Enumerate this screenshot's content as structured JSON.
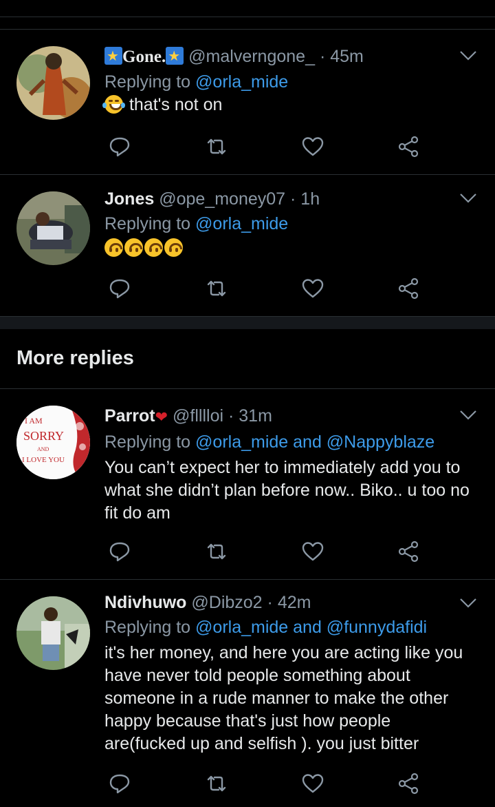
{
  "tweets": [
    {
      "name": "Gone.",
      "handle": "@malverngone_",
      "time": "45m",
      "reply_prefix": "Replying to",
      "mentions": "@orla_mide",
      "text": "that's not on",
      "emoji": "face-with-tears-of-joy"
    },
    {
      "name": "Jones",
      "handle": "@ope_money07",
      "time": "1h",
      "reply_prefix": "Replying to",
      "mentions": "@orla_mide",
      "emoji": "upside-down-face x4"
    },
    {
      "name": "Parrot",
      "handle": "@flllloi",
      "time": "31m",
      "reply_prefix": "Replying to",
      "mentions": "@orla_mide and @Nappyblaze",
      "text": "You can’t expect her to immediately add you to what she didn’t plan before now.. Biko.. u too no fit do am",
      "avatar_text": [
        "I AM",
        "SORRY",
        "AND",
        "I LOVE YOU"
      ]
    },
    {
      "name": "Ndivhuwo",
      "handle": "@Dibzo2",
      "time": "42m",
      "reply_prefix": "Replying to",
      "mentions": "@orla_mide and @funnydafidi",
      "text": "it's her money, and here you are acting like you have never told people something about someone in a rude manner to make the other happy because that's just how people are(fucked up and selfish ).  you just bitter"
    }
  ],
  "section": {
    "title": "More replies"
  },
  "sep_dot": "·",
  "icons": [
    "reply-icon",
    "retweet-icon",
    "like-icon",
    "share-icon",
    "chevron-down-icon"
  ],
  "colors": {
    "background": "#000000",
    "mention": "#3d9be9",
    "secondary": "#8b98a5",
    "primary_text": "#e7e9ea"
  }
}
